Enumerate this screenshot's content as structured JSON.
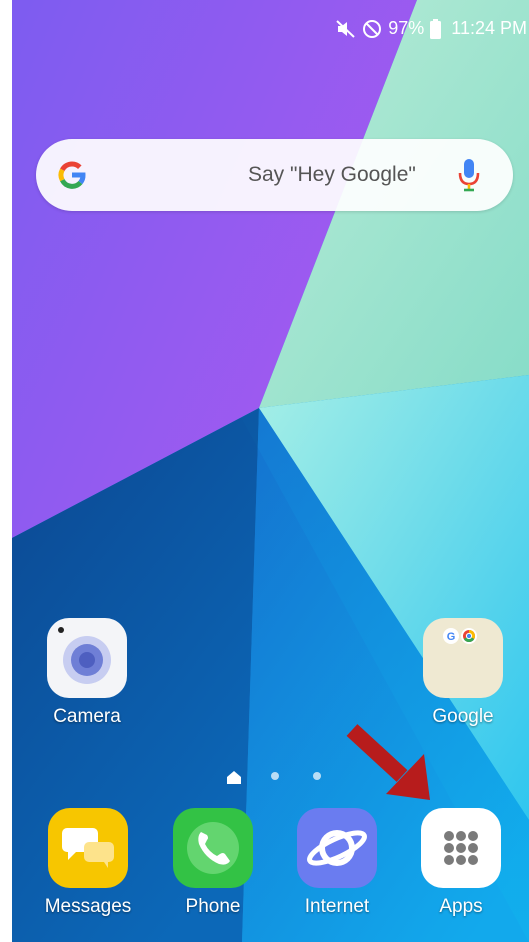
{
  "status_bar": {
    "battery_percent": "97%",
    "time": "11:24 PM",
    "icons": [
      "mute-icon",
      "do-not-disturb-icon",
      "battery-icon"
    ]
  },
  "search_bar": {
    "hint": "Say \"Hey Google\"",
    "left_icon": "google-g-icon",
    "right_icon": "microphone-icon"
  },
  "home_apps": [
    {
      "label": "Camera",
      "icon": "camera-icon"
    },
    {
      "label": "Google",
      "icon": "google-folder-icon"
    }
  ],
  "dock_apps": [
    {
      "label": "Messages",
      "icon": "messages-icon"
    },
    {
      "label": "Phone",
      "icon": "phone-icon"
    },
    {
      "label": "Internet",
      "icon": "internet-icon"
    },
    {
      "label": "Apps",
      "icon": "apps-grid-icon"
    }
  ],
  "page_indicator": {
    "pages": 3,
    "current": 0
  },
  "colors": {
    "annotation_arrow": "#b71c1c",
    "messages": "#f7c600",
    "phone": "#33c245",
    "internet": "#6a7cf0"
  }
}
